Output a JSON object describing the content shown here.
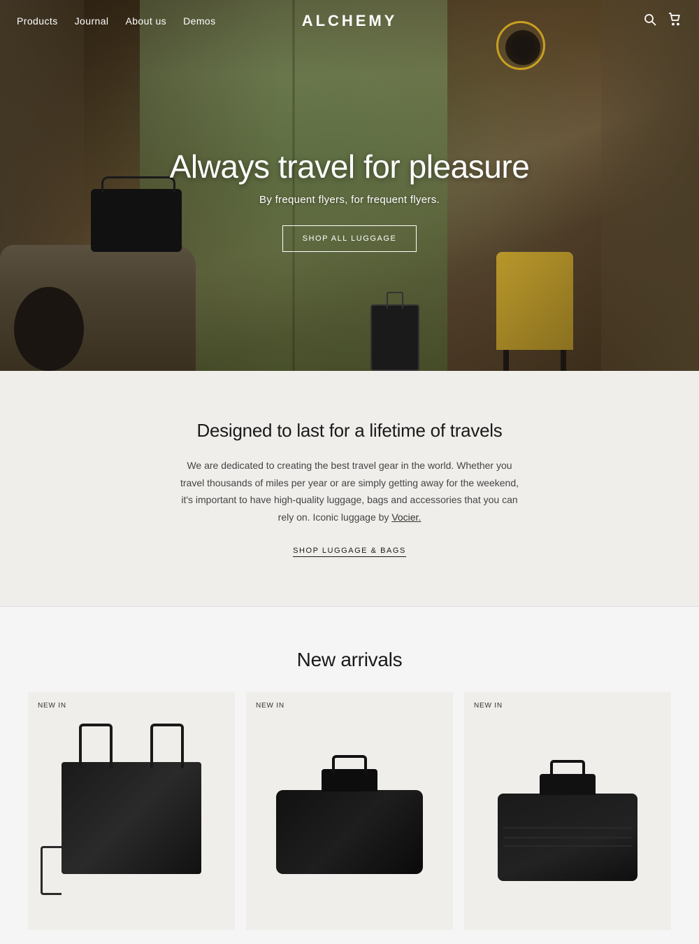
{
  "brand": "ALCHEMY",
  "nav": {
    "items": [
      {
        "id": "products",
        "label": "Products"
      },
      {
        "id": "journal",
        "label": "Journal"
      },
      {
        "id": "about",
        "label": "About us"
      },
      {
        "id": "demos",
        "label": "Demos"
      }
    ],
    "search_icon": "search",
    "cart_icon": "shopping-bag"
  },
  "hero": {
    "title": "Always travel for pleasure",
    "subtitle": "By frequent flyers, for frequent flyers.",
    "cta_label": "SHOP ALL LUGGAGE"
  },
  "mid_section": {
    "title": "Designed to last for a lifetime of travels",
    "body": "We are dedicated to creating the best travel gear in the world. Whether you travel thousands of miles per year or are simply getting away for the weekend, it's important to have high-quality luggage, bags and accessories that you can rely on. Iconic luggage by Vocier.",
    "cta_label": "SHOP LUGGAGE & BAGS",
    "inline_link": "Vocier."
  },
  "arrivals": {
    "title": "New arrivals",
    "badge": "NEW IN",
    "products": [
      {
        "id": "product-1",
        "badge": "NEW IN",
        "alt": "Black tote bag"
      },
      {
        "id": "product-2",
        "badge": "NEW IN",
        "alt": "Black duffel bag"
      },
      {
        "id": "product-3",
        "badge": "NEW IN",
        "alt": "Black weekender bag"
      }
    ]
  }
}
